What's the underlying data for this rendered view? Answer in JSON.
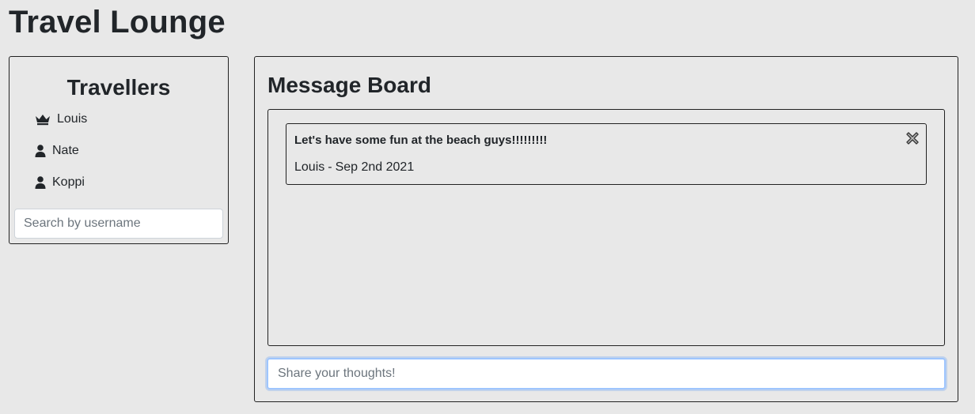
{
  "app": {
    "title": "Travel Lounge"
  },
  "travellers": {
    "title": "Travellers",
    "items": [
      {
        "name": "Louis",
        "icon": "crown-icon"
      },
      {
        "name": "Nate",
        "icon": "user-icon"
      },
      {
        "name": "Koppi",
        "icon": "user-icon"
      }
    ],
    "search": {
      "placeholder": "Search by username",
      "value": ""
    }
  },
  "board": {
    "title": "Message Board",
    "messages": [
      {
        "text": "Let's have some fun at the beach guys!!!!!!!!!",
        "author": "Louis",
        "separator": "-",
        "date": "Sep 2nd 2021",
        "delete_icon": "close-icon"
      }
    ],
    "compose": {
      "placeholder": "Share your thoughts!",
      "value": ""
    }
  },
  "colors": {
    "background": "#e8e8e8",
    "text": "#212529",
    "border": "#222222",
    "focus_ring": "#9ec5fe"
  }
}
